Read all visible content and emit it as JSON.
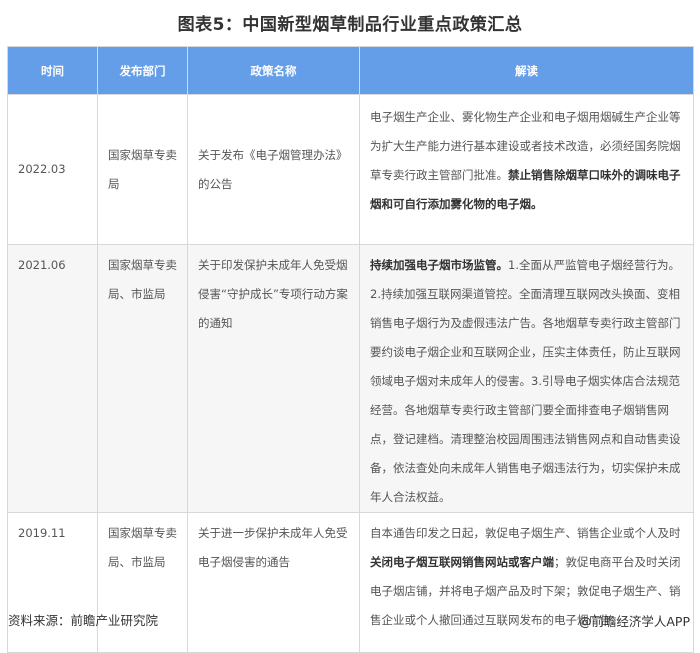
{
  "title": "图表5：中国新型烟草制品行业重点政策汇总",
  "headers": [
    "时间",
    "发布部门",
    "政策名称",
    "解读"
  ],
  "rows": [
    {
      "time": "2022.03",
      "dept": "国家烟草专卖局",
      "policy": "关于发布《电子烟管理办法》的公告",
      "desc_plain": "电子烟生产企业、雾化物生产企业和电子烟用烟碱生产企业等为扩大生产能力进行基本建设或者技术改造，必须经国务院烟草专卖行政主管部门批准。",
      "desc_bold": "禁止销售除烟草口味外的调味电子烟和可自行添加雾化物的电子烟。"
    },
    {
      "time": "2021.06",
      "dept": "国家烟草专卖局、市监局",
      "policy": "关于印发保护未成年人免受烟侵害“守护成长”专项行动方案的通知",
      "desc_bold": "持续加强电子烟市场监管。",
      "desc_plain": "1.全面从严监管电子烟经营行为。2.持续加强互联网渠道管控。全面清理互联网改头换面、变相销售电子烟行为及虚假违法广告。各地烟草专卖行政主管部门要约谈电子烟企业和互联网企业，压实主体责任，防止互联网领域电子烟对未成年人的侵害。3.引导电子烟实体店合法规范经营。各地烟草专卖行政主管部门要全面排查电子烟销售网点，登记建档。清理整治校园周围违法销售网点和自动售卖设备，依法查处向未成年人销售电子烟违法行为，切实保护未成年人合法权益。"
    },
    {
      "time": "2019.11",
      "dept": "国家烟草专卖局、市监局",
      "policy": "关于进一步保护未成年人免受电子烟侵害的通告",
      "desc_pre": "自本通告印发之日起，敦促电子烟生产、销售企业或个人及时",
      "desc_bold": "关闭电子烟互联网销售网站或客户端",
      "desc_post": "；敦促电商平台及时关闭电子烟店铺，并将电子烟产品及时下架；敦促电子烟生产、销售企业或个人撤回通过互联网发布的电子烟广告。"
    }
  ],
  "footer": {
    "source": "资料来源：前瞻产业研究院",
    "credit": "@前瞻经济学人APP"
  },
  "colors": {
    "header_bg": "#659ee8",
    "alt_row_bg": "#f6f6f6"
  }
}
